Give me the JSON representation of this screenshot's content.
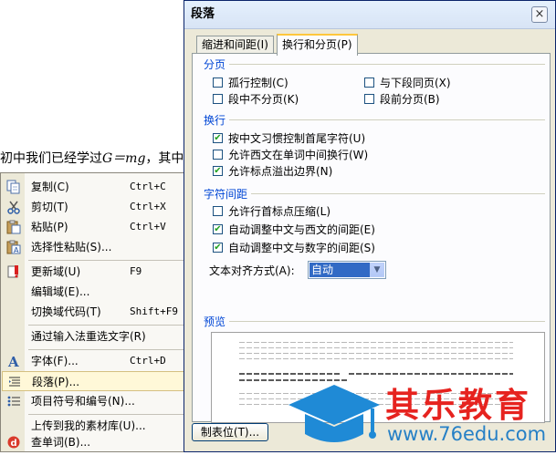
{
  "document": {
    "text_before": "初中我们已经学过",
    "formula": "G＝mg",
    "text_after": "，其中"
  },
  "context_menu": {
    "items": [
      {
        "label": "复制(C)",
        "shortcut": "Ctrl+C",
        "icon": "copy-icon"
      },
      {
        "label": "剪切(T)",
        "shortcut": "Ctrl+X",
        "icon": "scissors-icon"
      },
      {
        "label": "粘贴(P)",
        "shortcut": "Ctrl+V",
        "icon": "paste-icon"
      },
      {
        "label": "选择性粘贴(S)...",
        "shortcut": "",
        "icon": "paste-special-icon"
      },
      {
        "label": "更新域(U)",
        "shortcut": "F9",
        "icon": "update-field-icon"
      },
      {
        "label": "编辑域(E)...",
        "shortcut": "",
        "icon": ""
      },
      {
        "label": "切换域代码(T)",
        "shortcut": "Shift+F9",
        "icon": ""
      },
      {
        "label": "通过输入法重选文字(R)",
        "shortcut": "",
        "icon": ""
      },
      {
        "label": "字体(F)...",
        "shortcut": "Ctrl+D",
        "icon": "font-icon"
      },
      {
        "label": "段落(P)...",
        "shortcut": "",
        "icon": "paragraph-icon"
      },
      {
        "label": "项目符号和编号(N)...",
        "shortcut": "",
        "icon": "bullets-icon"
      },
      {
        "label": "上传到我的素材库(U)...",
        "shortcut": "",
        "icon": ""
      },
      {
        "label": "查单词(B)...",
        "shortcut": "",
        "icon": "lookup-icon"
      }
    ]
  },
  "dialog": {
    "title": "段落",
    "close_glyph": "×",
    "tabs": [
      {
        "label": "缩进和间距(I)",
        "active": false
      },
      {
        "label": "换行和分页(P)",
        "active": true
      }
    ],
    "sections": {
      "pagination": {
        "title": "分页",
        "options": [
          {
            "label": "孤行控制(C)",
            "checked": false
          },
          {
            "label": "与下段同页(X)",
            "checked": false
          },
          {
            "label": "段中不分页(K)",
            "checked": false
          },
          {
            "label": "段前分页(B)",
            "checked": false
          }
        ]
      },
      "line_break": {
        "title": "换行",
        "options": [
          {
            "label": "按中文习惯控制首尾字符(U)",
            "checked": true
          },
          {
            "label": "允许西文在单词中间换行(W)",
            "checked": false
          },
          {
            "label": "允许标点溢出边界(N)",
            "checked": true
          }
        ]
      },
      "char_spacing": {
        "title": "字符间距",
        "options": [
          {
            "label": "允许行首标点压缩(L)",
            "checked": false
          },
          {
            "label": "自动调整中文与西文的间距(E)",
            "checked": true
          },
          {
            "label": "自动调整中文与数字的间距(S)",
            "checked": true
          }
        ],
        "alignment_label": "文本对齐方式(A):",
        "alignment_value": "自动"
      },
      "preview": {
        "title": "预览"
      }
    },
    "tabs_button": "制表位(T)..."
  },
  "watermark": {
    "brand": "其乐教育",
    "url": "www.76edu.com"
  },
  "colors": {
    "group_title": "#0046d5",
    "check": "#21a121",
    "selection": "#316ac5",
    "watermark_red": "#e6231f",
    "watermark_blue": "#2680c6"
  }
}
